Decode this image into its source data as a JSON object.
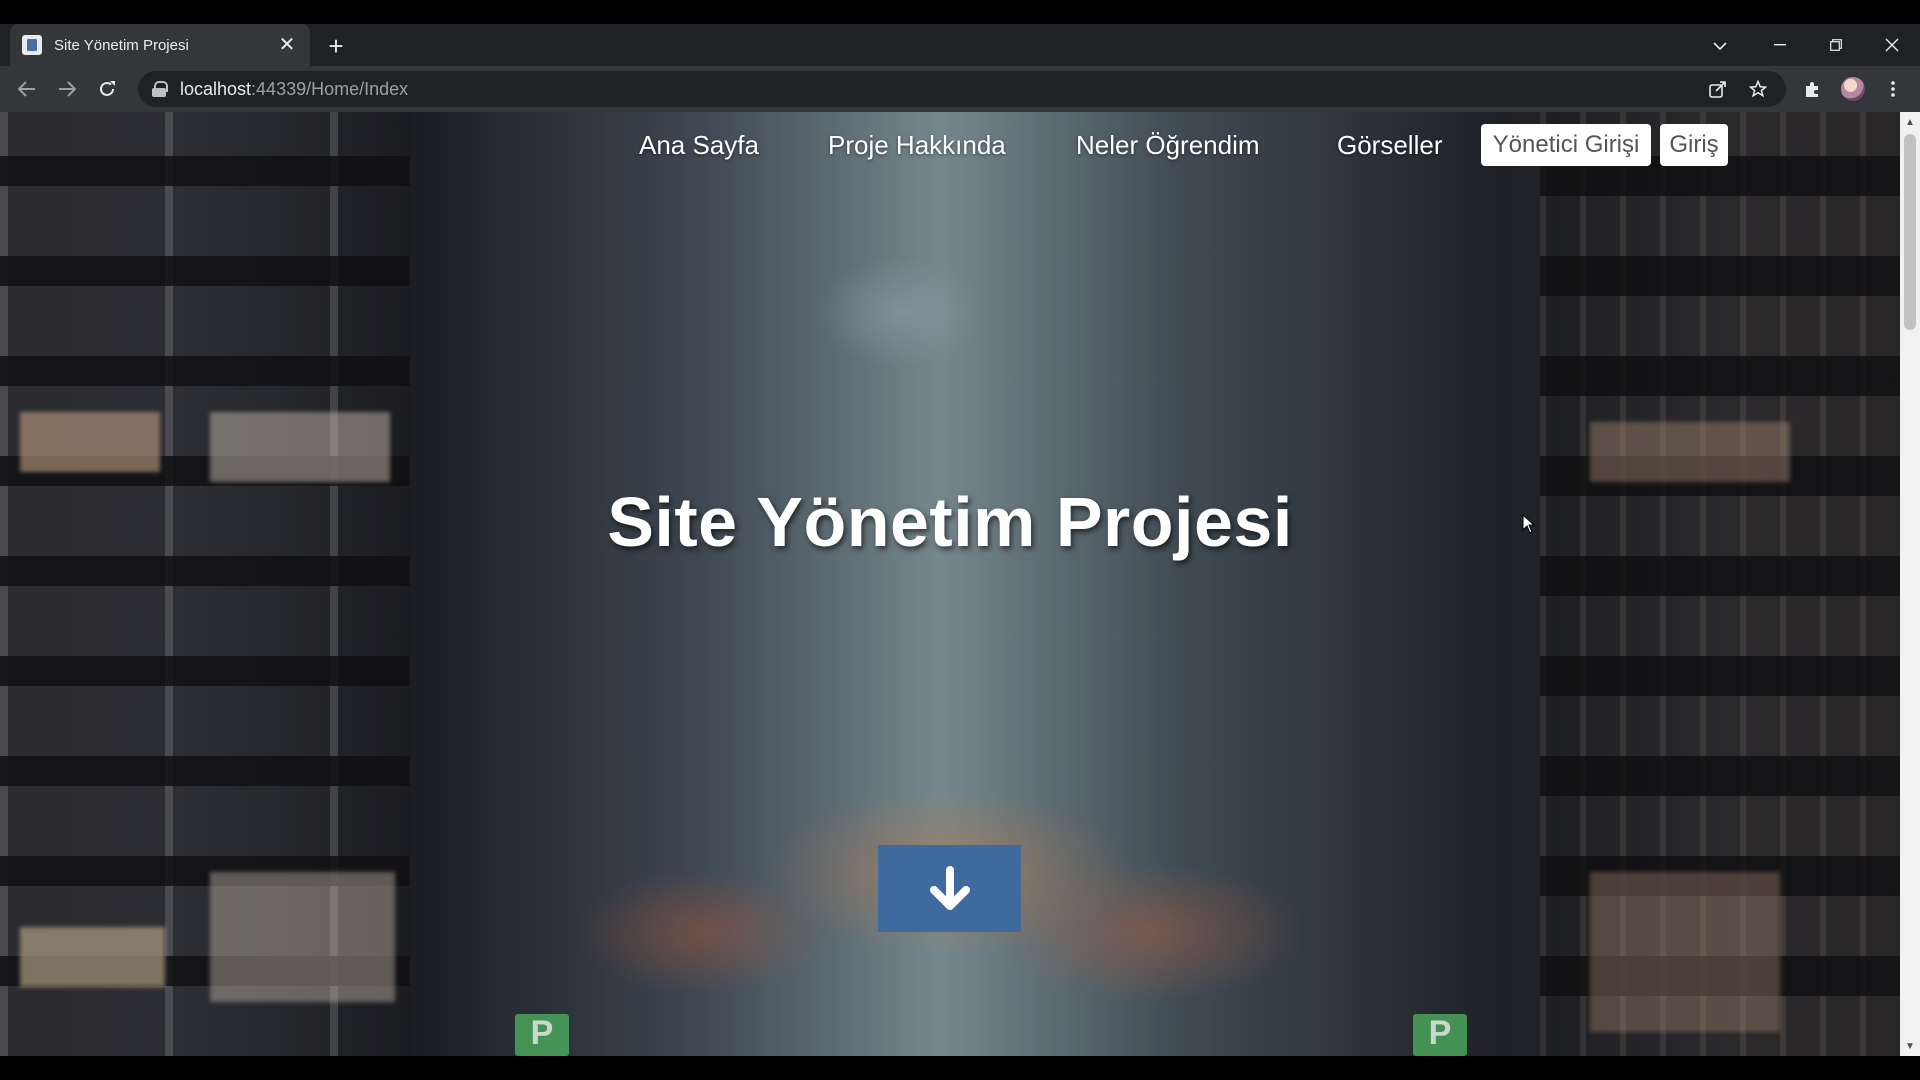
{
  "browser": {
    "tab_title": "Site Yönetim Projesi",
    "tab_close": "✕",
    "new_tab": "+",
    "url_host": "localhost",
    "url_path": ":44339/Home/Index"
  },
  "nav": {
    "items": [
      {
        "label": "Ana Sayfa"
      },
      {
        "label": "Proje Hakkında"
      },
      {
        "label": "Neler Öğrendim"
      },
      {
        "label": "Görseller"
      }
    ],
    "admin_login": "Yönetici Girişi",
    "login": "Giriş"
  },
  "hero": {
    "title": "Site Yönetim Projesi"
  },
  "colors": {
    "scroll_button": "#3f6a9d",
    "chrome_dark": "#202124",
    "chrome_toolbar": "#35363a"
  }
}
